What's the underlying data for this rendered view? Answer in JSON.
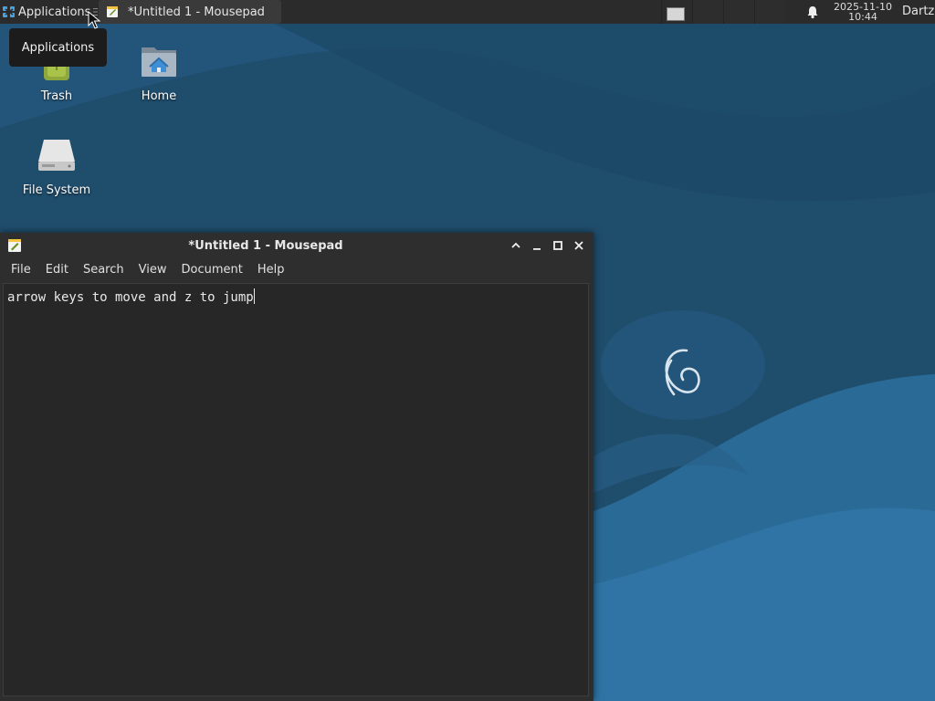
{
  "panel": {
    "applications_label": "Applications",
    "taskbar_window_title": "*Untitled 1 - Mousepad",
    "clock_date": "2025-11-10",
    "clock_time": "10:44",
    "user_name": "Dartz",
    "workspace_count": 4,
    "active_workspace": 1
  },
  "tooltip": {
    "text": "Applications"
  },
  "desktop": {
    "icons": [
      {
        "label": "Trash",
        "icon": "trash-icon"
      },
      {
        "label": "Home",
        "icon": "home-folder-icon"
      },
      {
        "label": "File System",
        "icon": "drive-icon"
      }
    ]
  },
  "window": {
    "title": "*Untitled 1 - Mousepad",
    "menu": [
      "File",
      "Edit",
      "Search",
      "View",
      "Document",
      "Help"
    ],
    "editor_text": "arrow keys to move and z to jump"
  },
  "colors": {
    "panel_bg": "#2b2b2b",
    "window_bg": "#2e2e2e",
    "editor_bg": "#272727",
    "desktop_bg": "#1f5071"
  }
}
